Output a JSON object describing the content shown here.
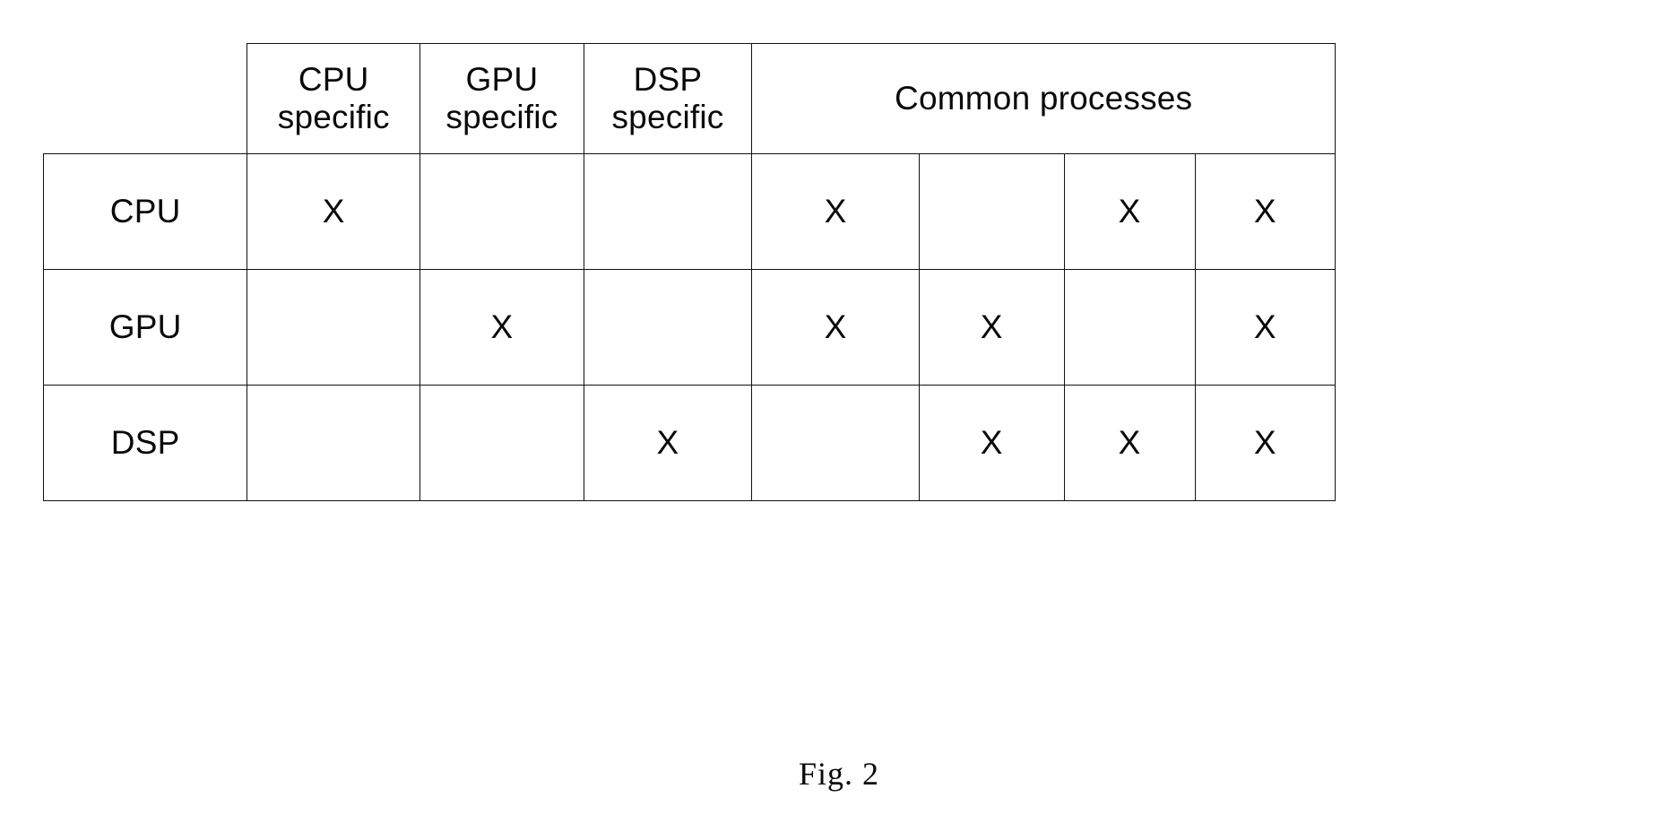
{
  "figure": {
    "caption": "Fig. 2"
  },
  "table": {
    "column_headers": [
      {
        "id": "corner",
        "label": "",
        "lines": []
      },
      {
        "id": "cpu-specific",
        "label": "CPU specific",
        "lines": [
          "CPU",
          "specific"
        ]
      },
      {
        "id": "gpu-specific",
        "label": "GPU specific",
        "lines": [
          "GPU",
          "specific"
        ]
      },
      {
        "id": "dsp-specific",
        "label": "DSP specific",
        "lines": [
          "DSP",
          "specific"
        ]
      },
      {
        "id": "common-processes",
        "label": "Common processes",
        "colspan": 4
      }
    ],
    "common_header": "Common processes",
    "common_header_colspan": 4,
    "mark": "X",
    "empty": "",
    "rows": [
      {
        "label": "CPU",
        "cells": [
          "X",
          "",
          "",
          "X",
          "",
          "X",
          "X"
        ]
      },
      {
        "label": "GPU",
        "cells": [
          "",
          "X",
          "",
          "X",
          "X",
          "",
          "X"
        ]
      },
      {
        "label": "DSP",
        "cells": [
          "",
          "",
          "X",
          "",
          "X",
          "X",
          "X"
        ]
      }
    ]
  }
}
